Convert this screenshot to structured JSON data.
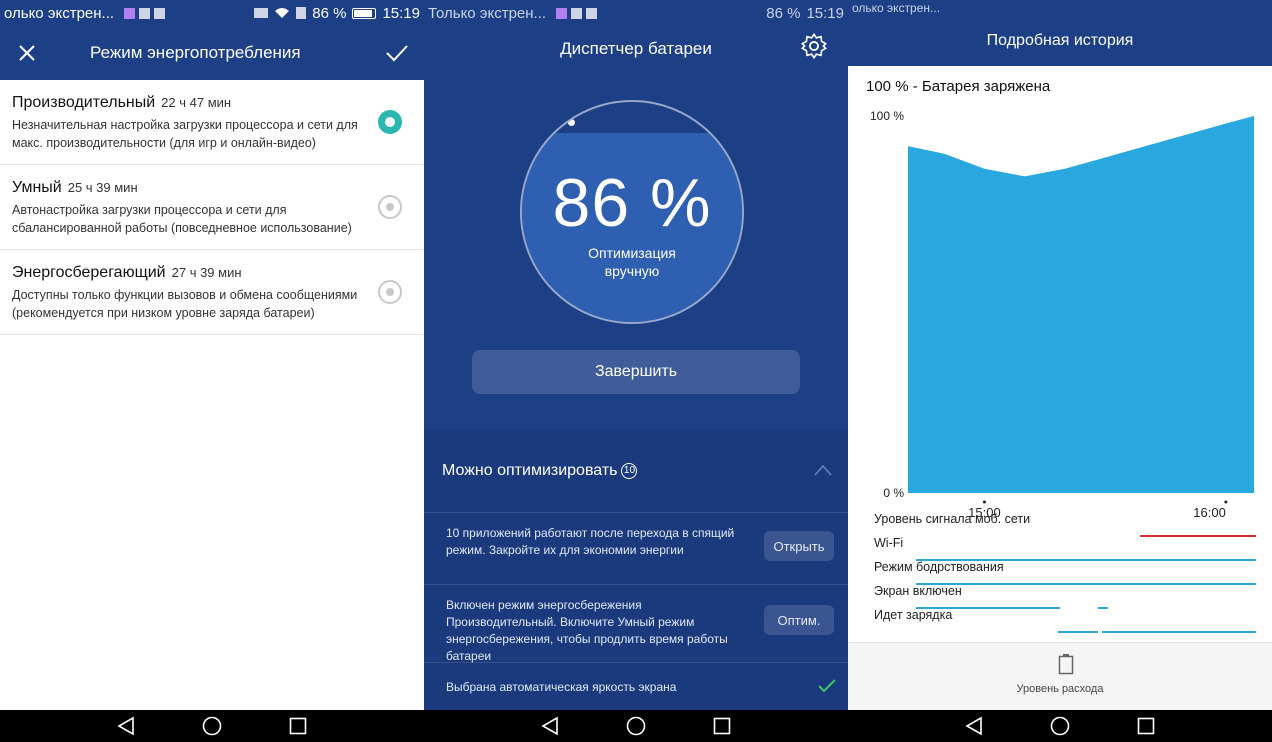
{
  "screen1": {
    "status": {
      "notification_text": "олько экстрен...",
      "battery_pct": "86 %",
      "time": "15:19"
    },
    "header": {
      "title": "Режим энергопотребления"
    },
    "modes": [
      {
        "name": "Производительный",
        "time": "22 ч 47 мин",
        "desc": "Незначительная настройка загрузки процессора и сети для макс. производительности (для игр и онлайн-видео)",
        "selected": true
      },
      {
        "name": "Умный",
        "time": "25 ч 39 мин",
        "desc": "Автонастройка загрузки процессора и сети для сбалансированной работы (повседневное использование)",
        "selected": false
      },
      {
        "name": "Энергосберегающий",
        "time": "27 ч 39 мин",
        "desc": "Доступны только функции вызовов и обмена сообщениями (рекомендуется при низком уровне заряда батареи)",
        "selected": false
      }
    ]
  },
  "screen2": {
    "status": {
      "notification_text": "Только экстрен...",
      "battery_pct": "86 %",
      "time": "15:19"
    },
    "header": {
      "title": "Диспетчер батареи"
    },
    "gauge": {
      "percent": "86 %",
      "subtitle_line1": "Оптимизация",
      "subtitle_line2": "вручную",
      "level": 0.86
    },
    "finish_button": "Завершить",
    "optimize": {
      "heading": "Можно оптимизировать",
      "count": "10",
      "items": [
        {
          "text": "10 приложений работают после перехода в спящий режим. Закройте их для экономии энергии",
          "action": "Открыть"
        },
        {
          "text": "Включен режим энергосбережения Производительный. Включите Умный режим энергосбережения, чтобы продлить время работы батареи",
          "action": "Оптим."
        },
        {
          "text": "Выбрана автоматическая яркость экрана",
          "action": ""
        }
      ]
    }
  },
  "screen3": {
    "status": {
      "notification_text": "олько экстрен..."
    },
    "header": {
      "title": "Подробная история"
    },
    "history_title": "100 % - Батарея заряжена",
    "metrics": [
      "Уровень сигнала моб. сети",
      "Wi-Fi",
      "Режим бодрствования",
      "Экран включен",
      "Идет зарядка"
    ],
    "usage_label": "Уровень расхода",
    "colors": {
      "area": "#29a8e0",
      "signal": "#d32f2f",
      "line": "#29a8e0"
    }
  },
  "chart_data": {
    "type": "area",
    "x": [
      "14:41",
      "14:50",
      "15:00",
      "15:10",
      "15:20",
      "15:30",
      "15:40",
      "16:00",
      "16:07"
    ],
    "y": [
      92,
      90,
      86,
      84,
      86,
      89,
      92,
      98,
      100
    ],
    "ylim": [
      0,
      100
    ],
    "y_tick_labels": [
      "0 %",
      "100 %"
    ],
    "x_tick_labels": [
      "15:00",
      "16:00"
    ]
  }
}
